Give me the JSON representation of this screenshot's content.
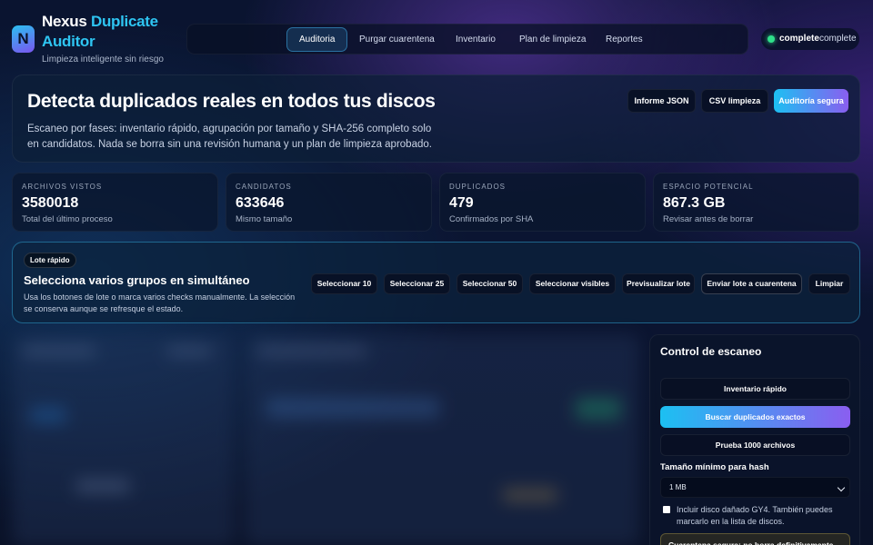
{
  "brand": {
    "logo_letter": "N",
    "name_part1": "Nexus",
    "name_part2": "Duplicate",
    "name_part3": "Auditor",
    "tagline": "Limpieza inteligente sin riesgo"
  },
  "nav": {
    "items": [
      {
        "label": "Auditoria",
        "active": true
      },
      {
        "label": "Purgar cuarentena",
        "active": false
      },
      {
        "label": "Inventario",
        "active": false
      },
      {
        "label": "Plan de limpieza",
        "active": false
      },
      {
        "label": "Reportes",
        "active": false
      }
    ]
  },
  "status": {
    "bold": "complete",
    "plain": "complete",
    "color": "#2fe08a"
  },
  "hero": {
    "title": "Detecta duplicados reales en todos tus discos",
    "description": "Escaneo por fases: inventario rápido, agrupación por tamaño y SHA-256 completo solo en candidatos. Nada se borra sin una revisión humana y un plan de limpieza aprobado.",
    "buttons": {
      "json": "Informe JSON",
      "csv": "CSV limpieza",
      "audit": "Auditoría segura"
    }
  },
  "stats": [
    {
      "label": "Archivos vistos",
      "value": "3580018",
      "sub": "Total del último proceso"
    },
    {
      "label": "Candidatos",
      "value": "633646",
      "sub": "Mismo tamaño"
    },
    {
      "label": "Duplicados",
      "value": "479",
      "sub": "Confirmados por SHA"
    },
    {
      "label": "Espacio potencial",
      "value": "867.3 GB",
      "sub": "Revisar antes de borrar"
    }
  ],
  "batch": {
    "badge": "Lote rápido",
    "title": "Selecciona varios grupos en simultáneo",
    "description": "Usa los botones de lote o marca varios checks manualmente. La selección se conserva aunque se refresque el estado.",
    "buttons": [
      "Seleccionar 10",
      "Seleccionar 25",
      "Seleccionar 50",
      "Seleccionar visibles",
      "Previsualizar lote",
      "Enviar lote a cuarentena",
      "Limpiar"
    ]
  },
  "scan_control": {
    "title": "Control de escaneo",
    "quick_inventory": "Inventario rápido",
    "find_exact": "Buscar duplicados exactos",
    "test_1000": "Prueba 1000 archivos",
    "min_size_label": "Tamaño mínimo para hash",
    "min_size_value": "1 MB",
    "include_disk_label": "Incluir disco dañado GY4. También puedes marcarlo en la lista de discos.",
    "warning": "Cuarentena segura: no borra definitivamente"
  },
  "colors": {
    "accent": "#2ec5f2",
    "accent2": "#8a5ef0"
  }
}
